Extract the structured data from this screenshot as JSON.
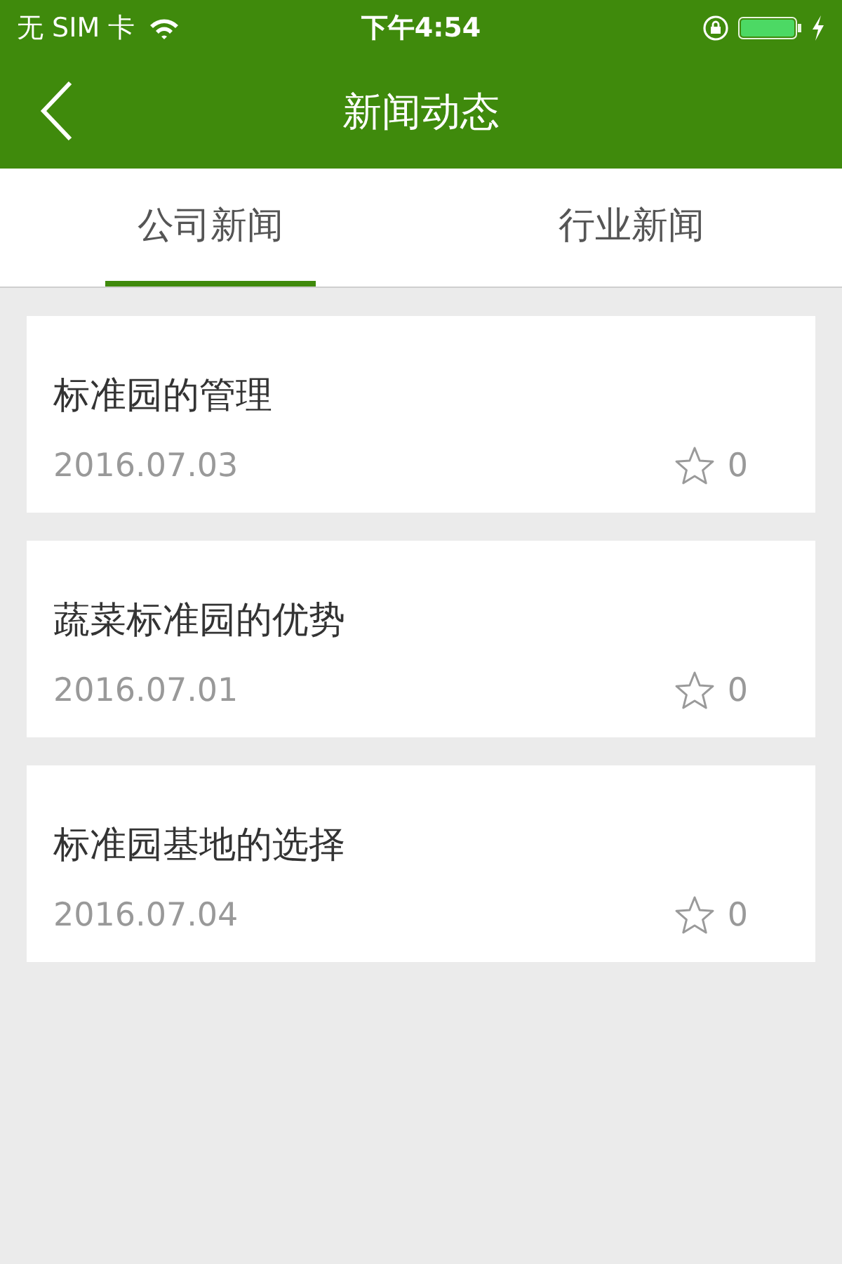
{
  "status_bar": {
    "carrier": "无 SIM 卡",
    "time": "下午4:54"
  },
  "nav": {
    "title": "新闻动态"
  },
  "tabs": [
    {
      "label": "公司新闻",
      "selected": true
    },
    {
      "label": "行业新闻",
      "selected": false
    }
  ],
  "news": [
    {
      "title": "标准园的管理",
      "date": "2016.07.03",
      "favorites": "0"
    },
    {
      "title": "蔬菜标准园的优势",
      "date": "2016.07.01",
      "favorites": "0"
    },
    {
      "title": "标准园基地的选择",
      "date": "2016.07.04",
      "favorites": "0"
    }
  ]
}
